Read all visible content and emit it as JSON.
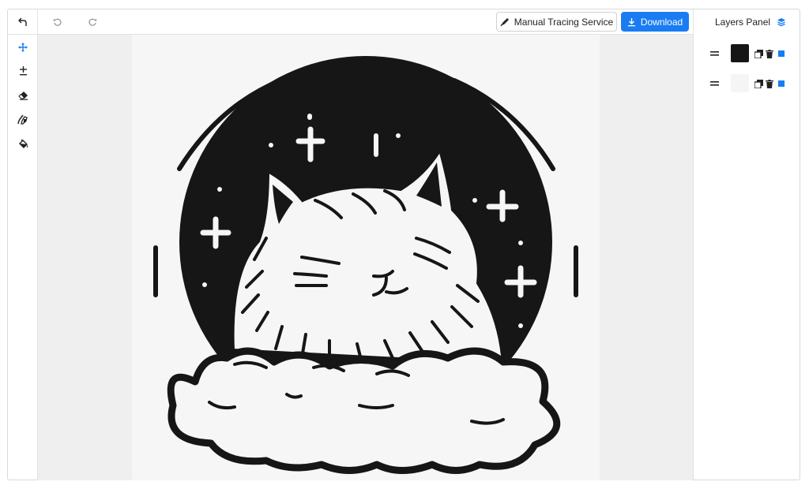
{
  "toolbar": {
    "manual_tracing_label": "Manual Tracing Service",
    "download_label": "Download"
  },
  "tools": [
    {
      "name": "move-tool",
      "icon": "move-arrows-icon",
      "active": true
    },
    {
      "name": "plus-minus-tool",
      "icon": "plus-minus-icon",
      "active": false
    },
    {
      "name": "eraser-tool",
      "icon": "eraser-icon",
      "active": false
    },
    {
      "name": "brush-tool",
      "icon": "brush-icon",
      "active": false
    },
    {
      "name": "fill-tool",
      "icon": "paint-bucket-icon",
      "active": false
    }
  ],
  "layers_panel": {
    "title": "Layers Panel",
    "layers": [
      {
        "swatch": "#161616",
        "color": "#1a7cf2"
      },
      {
        "swatch": "#f5f5f5",
        "color": "#1a7cf2"
      }
    ]
  },
  "colors": {
    "accent": "#1a7cf2",
    "ink": "#161616",
    "paper": "#f6f6f6",
    "canvas_bg": "#efefef"
  }
}
